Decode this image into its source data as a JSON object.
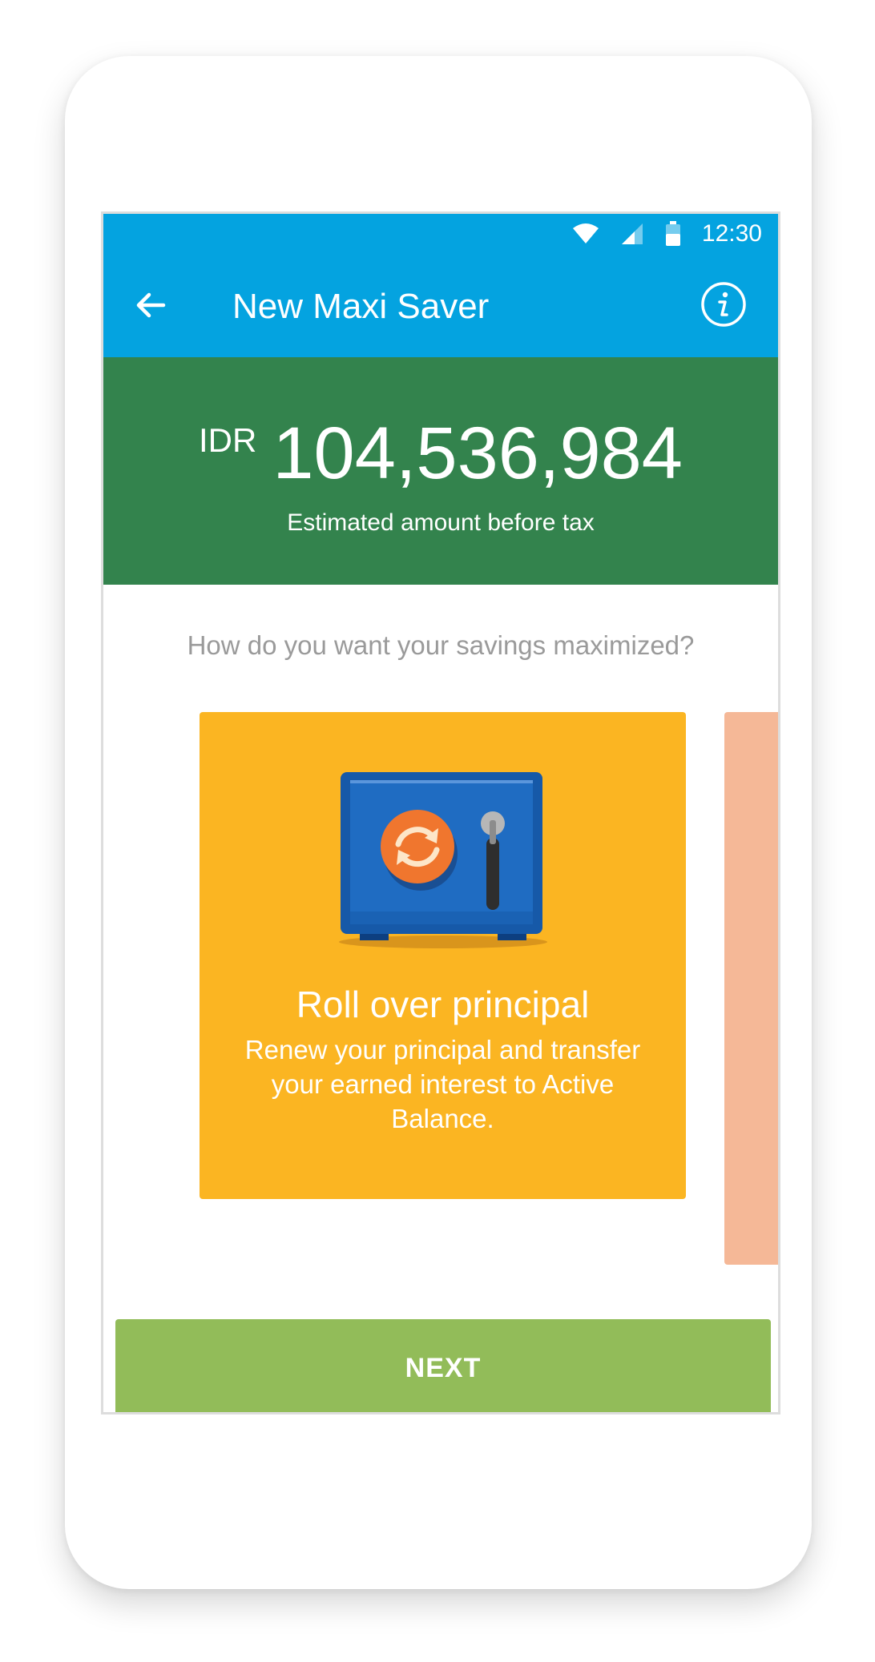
{
  "status_bar": {
    "time": "12:30"
  },
  "toolbar": {
    "title": "New Maxi Saver"
  },
  "summary": {
    "currency": "IDR",
    "amount": "104,536,984",
    "caption": "Estimated amount before tax"
  },
  "prompt": "How do you want your savings maximized?",
  "options": [
    {
      "title": "Roll over principal",
      "description": "Renew your principal and transfer your earned interest to Active Balance.",
      "color": "#fbb522"
    },
    {
      "color": "#f5b897"
    }
  ],
  "actions": {
    "next_label": "NEXT"
  },
  "colors": {
    "app_bar": "#04a3e0",
    "summary_panel": "#33834d",
    "next_button": "#92bc59"
  },
  "icons": [
    "wifi-icon",
    "signal-icon",
    "battery-icon",
    "back-arrow-icon",
    "info-icon",
    "safe-icon",
    "refresh-icon"
  ]
}
